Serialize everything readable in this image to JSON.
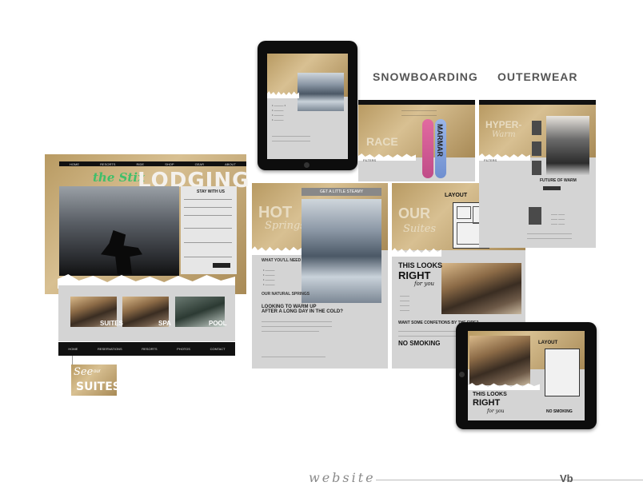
{
  "headings": {
    "snowboarding": "SNOWBOARDING",
    "outerwear": "OUTERWEAR"
  },
  "lodging_page": {
    "logo": "the Stix",
    "title": "LODGING",
    "nav_items": [
      "HOME",
      "RESORTS",
      "RIDE",
      "SHOP",
      "GEAR",
      "ABOUT"
    ],
    "stay_label": "STAY WITH US",
    "suite_labels": [
      "SUITES",
      "SPA",
      "POOL"
    ],
    "footer_nav": [
      "HOME",
      "RESERVATIONS",
      "RESORTS",
      "PHOTOS",
      "CONTACT"
    ]
  },
  "see_our_suites": {
    "line1": "See",
    "line2": "our",
    "line3": "SUITES"
  },
  "hot_springs_page": {
    "banner": "GET A LITTLE STEAMY",
    "title_line1": "HOT",
    "title_line2": "Springs",
    "section1": "WHAT YOU'LL NEED",
    "section2": "OUR NATURAL SPRINGS",
    "section3": "LOOKING TO WARM UP\nAFTER A LONG DAY IN THE COLD?"
  },
  "suites_page": {
    "title_line1": "OUR",
    "title_line2": "Suites",
    "layout_label": "LAYOUT",
    "looks_line1": "THIS LOOKS",
    "looks_line2": "RIGHT",
    "looks_line3": "for you",
    "want": "WANT SOME CONFETIONS BY THE FIRE?",
    "no_smoking": "NO SMOKING"
  },
  "snowboard_page": {
    "title": "RACE",
    "board_text": "MARMAR",
    "filters_label": "FILTERS"
  },
  "outerwear_page": {
    "title_line1": "HYPER-",
    "title_line2": "Warm",
    "filters_label": "FILTERS",
    "future_label": "FUTURE OF WARM"
  },
  "ipad_bottom": {
    "layout_label": "LAYOUT",
    "looks_line1": "THIS LOOKS",
    "looks_line2": "RIGHT",
    "looks_line3": "for you",
    "no_smoking": "NO SMOKING"
  },
  "footer": {
    "script_label": "website",
    "page_code": "Vb"
  },
  "colors": {
    "gold": "#b89a62",
    "dark": "#111111",
    "gray": "#d4d4d4",
    "accent_green": "#3fbf6a"
  }
}
